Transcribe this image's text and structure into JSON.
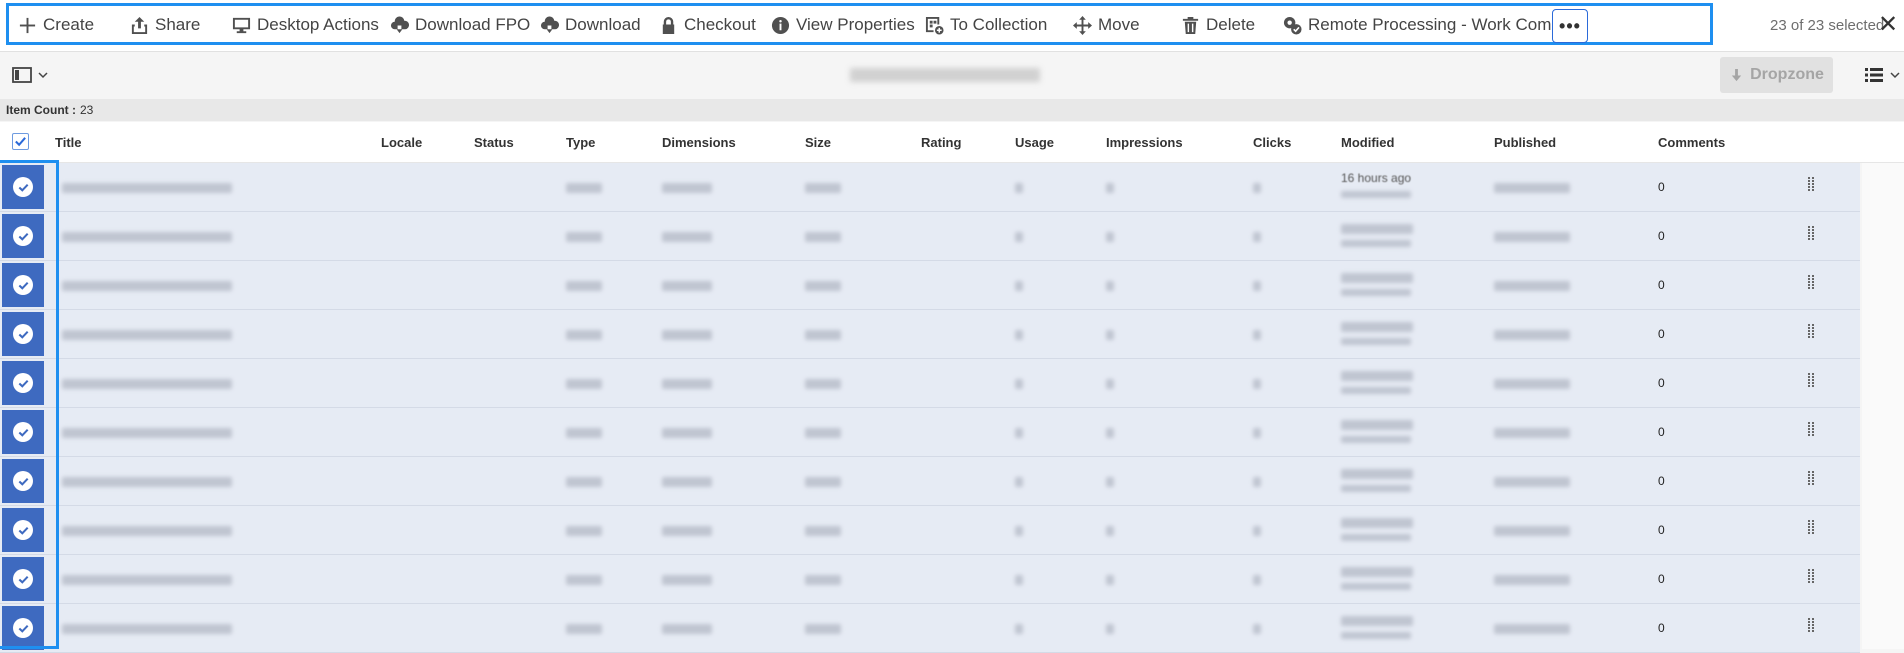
{
  "toolbar": {
    "actions": [
      {
        "label": "Create",
        "icon": "plus-icon"
      },
      {
        "label": "Share",
        "icon": "share-icon"
      },
      {
        "label": "Desktop Actions",
        "icon": "desktop-icon"
      },
      {
        "label": "Download FPO",
        "icon": "cloud-download-icon"
      },
      {
        "label": "Download",
        "icon": "cloud-download-icon"
      },
      {
        "label": "Checkout",
        "icon": "lock-icon"
      },
      {
        "label": "View Properties",
        "icon": "info-icon"
      },
      {
        "label": "To Collection",
        "icon": "add-to-collection-icon"
      },
      {
        "label": "Move",
        "icon": "move-icon"
      },
      {
        "label": "Delete",
        "icon": "trash-icon"
      },
      {
        "label": "Remote Processing - Work Complete",
        "icon": "remote-processing-icon"
      }
    ],
    "more_label": "•••",
    "selection_text": "23 of 23 selected",
    "close_label": "✕"
  },
  "subbar": {
    "dropzone_label": "Dropzone",
    "view_toggle_icon": "rail-toggle-icon",
    "view_switcher_icon": "list-view-icon"
  },
  "item_count": {
    "label": "Item Count :",
    "value": "23"
  },
  "table": {
    "columns": [
      "Title",
      "Locale",
      "Status",
      "Type",
      "Dimensions",
      "Size",
      "Rating",
      "Usage",
      "Impressions",
      "Clicks",
      "Modified",
      "Published",
      "Comments"
    ],
    "rows": [
      {
        "modified": "16 hours ago",
        "comments": "0"
      },
      {
        "comments": "0"
      },
      {
        "comments": "0"
      },
      {
        "comments": "0"
      },
      {
        "comments": "0"
      },
      {
        "comments": "0"
      },
      {
        "comments": "0"
      },
      {
        "comments": "0"
      },
      {
        "comments": "0"
      },
      {
        "comments": "0"
      }
    ]
  },
  "colors": {
    "accent": "#1e8ff0",
    "selected_check": "#3e6ac0",
    "row_selected_bg": "#e6ebf4"
  }
}
